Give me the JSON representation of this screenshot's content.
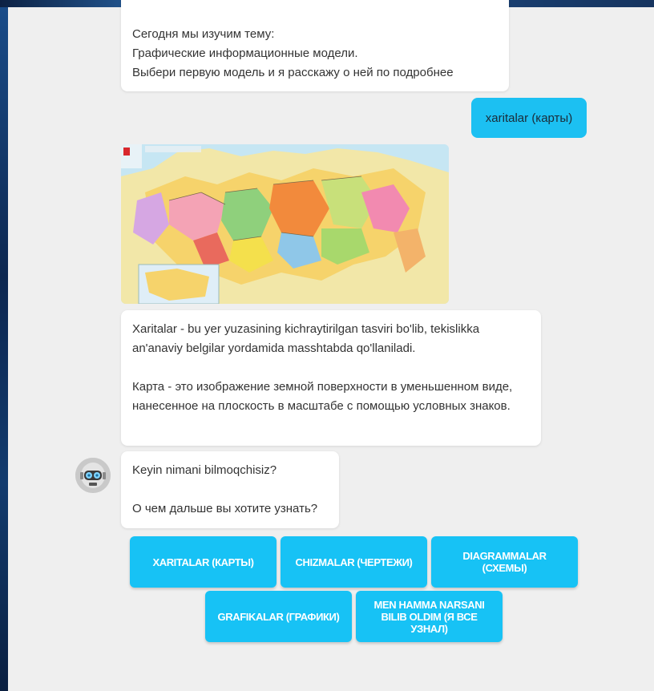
{
  "colors": {
    "accent": "#17c2f5",
    "user_bubble": "#1cc0f2",
    "panel": "#efefef"
  },
  "messages": {
    "intro": [
      "Сегодня мы изучим тему:",
      "Графические информационные модели.",
      "Выбери первую модель и я расскажу о ней по подробнее"
    ],
    "user_reply": "xaritalar (карты)",
    "map_image": "russia-political-map",
    "definition": {
      "uz": "Xaritalar - bu yer yuzasining kichraytirilgan tasviri bo'lib, tekislikka an'anaviy belgilar yordamida masshtabda qo'llaniladi.",
      "ru": "Карта - это изображение земной поверхности в уменьшенном виде, нанесенное на плоскость в масштабе с помощью условных знаков."
    },
    "question": {
      "uz": "Keyin nimani bilmoqchisiz?",
      "ru": "О чем дальше вы хотите узнать?"
    }
  },
  "options": [
    "XARITALAR (КАРТЫ)",
    "CHIZMALAR (ЧЕРТЕЖИ)",
    "DIAGRAMMALAR (СХЕМЫ)",
    "GRAFIKALAR (ГРАФИКИ)",
    "MEN HAMMA NARSANI BILIB OLDIM (Я ВСЕ УЗНАЛ)"
  ]
}
